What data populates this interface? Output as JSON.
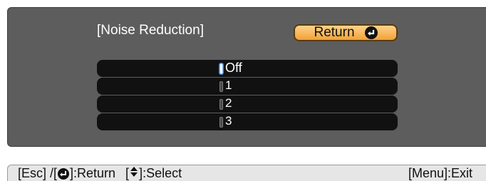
{
  "menu": {
    "title": "[Noise Reduction]",
    "return_label": "Return",
    "options": [
      {
        "label": "Off",
        "selected": true
      },
      {
        "label": "1",
        "selected": false
      },
      {
        "label": "2",
        "selected": false
      },
      {
        "label": "3",
        "selected": false
      }
    ]
  },
  "footer": {
    "esc_label": "[Esc] /[",
    "return_label": "]:Return",
    "select_prefix": "[",
    "select_label": "]:Select",
    "exit_label": "[Menu]:Exit"
  },
  "icons": {
    "return_icon": "enter-icon",
    "select_icon": "updown-icon"
  },
  "colors": {
    "panel_bg": "#5d5d5d",
    "option_bg": "#111111",
    "button_accent": "#f0a238",
    "footer_bg": "#e6e6e6"
  }
}
